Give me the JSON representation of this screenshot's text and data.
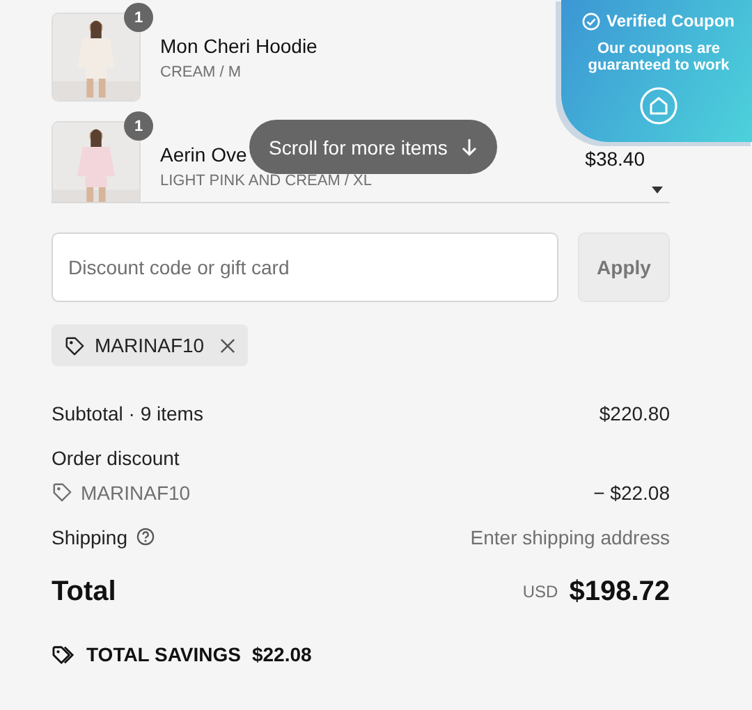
{
  "cart": {
    "items": [
      {
        "name": "Mon Cheri Hoodie",
        "variant": "CREAM / M",
        "quantity": "1"
      },
      {
        "name": "Aerin Ove",
        "variant": "LIGHT PINK AND CREAM / XL",
        "quantity": "1",
        "price": "$38.40"
      }
    ],
    "scroll_hint": "Scroll for more items"
  },
  "coupon_banner": {
    "title": "Verified Coupon",
    "message": "Our coupons are guaranteed to work"
  },
  "discount": {
    "placeholder": "Discount code or gift card",
    "button": "Apply",
    "applied_codes": [
      {
        "code": "MARINAF10"
      }
    ]
  },
  "summary": {
    "subtotal_label": "Subtotal · 9 items",
    "subtotal": "$220.80",
    "order_discount_label": "Order discount",
    "discount_code": "MARINAF10",
    "discount_amount": "− $22.08",
    "shipping_label": "Shipping",
    "shipping_value": "Enter shipping address",
    "total_label": "Total",
    "currency": "USD",
    "total": "$198.72",
    "savings_label": "TOTAL SAVINGS",
    "savings": "$22.08"
  }
}
